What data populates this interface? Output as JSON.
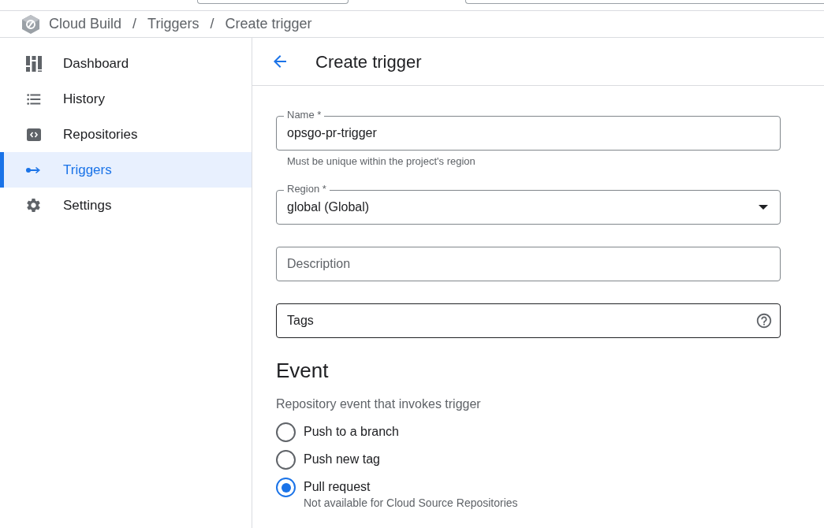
{
  "breadcrumb": [
    {
      "label": "Cloud Build"
    },
    {
      "separator": "/",
      "label": "Triggers"
    },
    {
      "separator": "/",
      "label": "Create trigger"
    }
  ],
  "sidebar": {
    "items": [
      {
        "label": "Dashboard",
        "selected": false
      },
      {
        "label": "History",
        "selected": false
      },
      {
        "label": "Repositories",
        "selected": false
      },
      {
        "label": "Triggers",
        "selected": true
      },
      {
        "label": "Settings",
        "selected": false
      }
    ]
  },
  "page_title": "Create trigger",
  "fields": [
    {
      "kind": "text",
      "label": "Name *",
      "value": "opsgo-pr-trigger",
      "hint": "Must be unique within the project's region",
      "focused": false
    },
    {
      "kind": "select",
      "label": "Region *",
      "value": "global (Global)",
      "focused": false
    },
    {
      "kind": "text",
      "placeholder": "Description",
      "focused": false
    },
    {
      "kind": "help",
      "placeholder": "Tags",
      "focused": true
    }
  ],
  "event": {
    "heading": "Event",
    "description": "Repository event that invokes trigger",
    "options": [
      {
        "label": "Push to a branch",
        "selected": false
      },
      {
        "label": "Push new tag",
        "selected": false
      },
      {
        "label": "Pull request",
        "selected": true,
        "hint": "Not available for Cloud Source Repositories"
      }
    ]
  }
}
